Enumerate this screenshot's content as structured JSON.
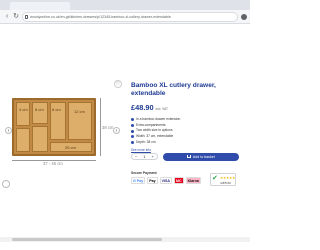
{
  "browser": {
    "url": "woodyonline.co.uk/en-gb/kitchen-drawers/p/12345-bamboo-xl-cutlery-drawer-extendable"
  },
  "product": {
    "title": "Bamboo XL cutlery drawer, extendable",
    "price": "£48.90",
    "vat_note": "incl. VAT",
    "bullets": [
      "In a bamboo drawer extension",
      "Extra compartments",
      "Two width size in options",
      "Width: 37 cm, extendable",
      "Depth: 38 cm"
    ],
    "more_link": "See more info",
    "quantity": "1",
    "add_to_cart": "Add to basket"
  },
  "image": {
    "compartments": [
      "4 cm",
      "8 cm",
      "8 cm",
      "12 cm",
      "25 cm"
    ],
    "width_label": "37 - 45 cm",
    "depth_label": "38 cm"
  },
  "payment": {
    "label": "Secure Payment",
    "methods": [
      "G Pay",
      "Pay",
      "VISA",
      "MC",
      "Klarna"
    ]
  },
  "trust": {
    "stars": "★★★★★",
    "rating": "4.8/5.00"
  },
  "colors": {
    "brand": "#1f3a93",
    "button": "#2f4cab"
  }
}
